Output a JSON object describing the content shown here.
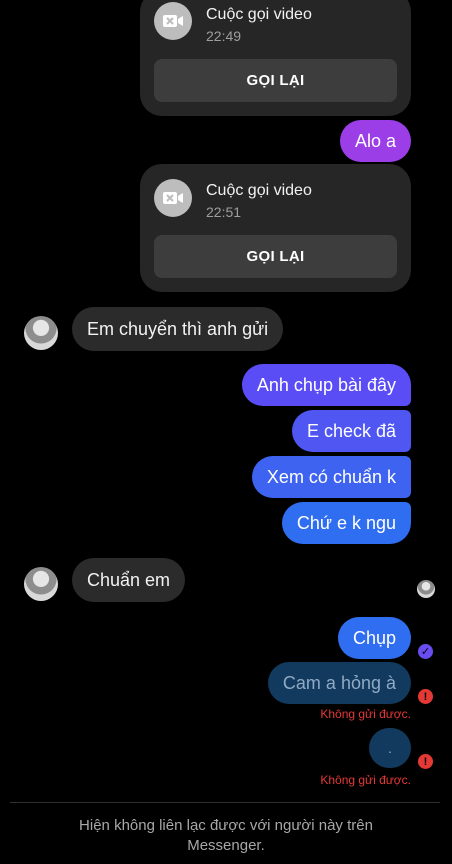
{
  "calls": [
    {
      "title": "Cuộc gọi video",
      "time": "22:49",
      "button": "GỌI LẠI"
    },
    {
      "title": "Cuộc gọi video",
      "time": "22:51",
      "button": "GỌI LẠI"
    }
  ],
  "messages": {
    "alo": "Alo a",
    "em_chuyen": "Em chuyển thì anh gửi",
    "anh_chup": "Anh chụp bài đây",
    "e_check": "E check đã",
    "xem_co": "Xem có chuẩn k",
    "chu_e": "Chứ e k ngu",
    "chuan_em": "Chuẩn em",
    "chup": "Chụp",
    "cam_a": "Cam a hỏng à",
    "dot": "."
  },
  "status": {
    "failed_1": "Không gửi được.",
    "failed_2": "Không gửi được.",
    "error_glyph": "!",
    "seen_glyph": "✓"
  },
  "footer": {
    "line1": "Hiện không liên lạc được với người này trên",
    "line2": "Messenger."
  },
  "colors": {
    "sent_purple": "#9b3ee8",
    "sent_indigo": "#5a4df5",
    "sent_blue": "#2f6ef0",
    "failed_bubble": "#123a5e",
    "error_red": "#e53935"
  },
  "icons": {
    "call": "video-camera-x-icon",
    "contact": "avatar",
    "error": "exclamation-icon",
    "seen": "check-circle-icon"
  }
}
